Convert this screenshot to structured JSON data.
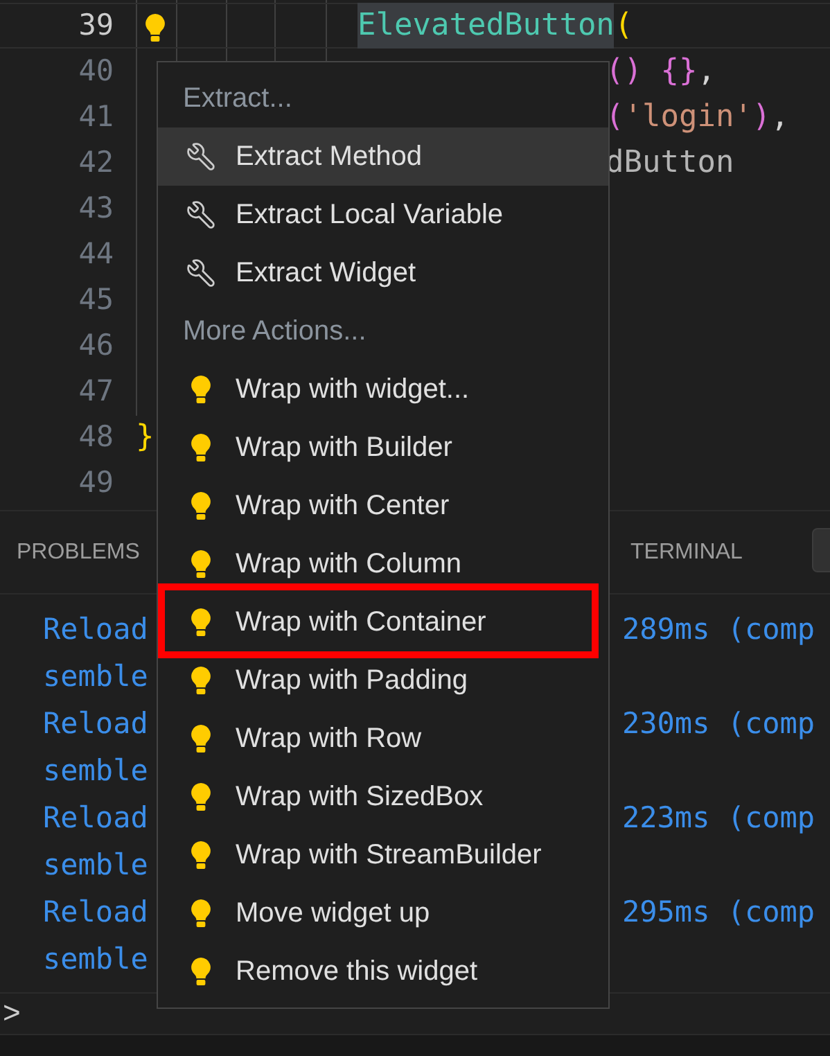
{
  "editor": {
    "lines": [
      {
        "number": "39",
        "current": true,
        "lightbulb": true,
        "code": [
          {
            "text": "ElevatedButton",
            "color": "#4ec9b0",
            "selected": true
          },
          {
            "text": "(",
            "color": "#ffd700",
            "selected": false
          }
        ]
      },
      {
        "number": "40",
        "current": false,
        "lightbulb": false,
        "code": [
          {
            "text": "()",
            "color": "#da70d6",
            "selected": false
          },
          {
            "text": " {}",
            "color": "#da70d6",
            "selected": false
          },
          {
            "text": ",",
            "color": "#d4d4d4",
            "selected": false
          }
        ]
      },
      {
        "number": "41",
        "current": false,
        "lightbulb": false,
        "code": [
          {
            "text": "(",
            "color": "#da70d6",
            "selected": false
          },
          {
            "text": "'login'",
            "color": "#ce9178",
            "selected": false
          },
          {
            "text": ")",
            "color": "#da70d6",
            "selected": false
          },
          {
            "text": ",",
            "color": "#d4d4d4",
            "selected": false
          }
        ]
      },
      {
        "number": "42",
        "current": false,
        "lightbulb": false,
        "code": [
          {
            "text": "dButton",
            "color": "#b4b4b4",
            "selected": false
          }
        ]
      },
      {
        "number": "43",
        "current": false,
        "lightbulb": false
      },
      {
        "number": "44",
        "current": false,
        "lightbulb": false
      },
      {
        "number": "45",
        "current": false,
        "lightbulb": false
      },
      {
        "number": "46",
        "current": false,
        "lightbulb": false
      },
      {
        "number": "47",
        "current": false,
        "lightbulb": false
      },
      {
        "number": "48",
        "current": false,
        "lightbulb": false,
        "code": [
          {
            "text": "}",
            "color": "#ffd700",
            "selected": false
          }
        ]
      },
      {
        "number": "49",
        "current": false,
        "lightbulb": false
      }
    ]
  },
  "panel": {
    "tabs": [
      {
        "label": "PROBLEMS",
        "selected": false
      },
      {
        "label": "TERMINAL",
        "selected": false
      }
    ],
    "terminal_lines": [
      {
        "left": "Reload",
        "right": "289ms (comp"
      },
      {
        "left": "semble"
      },
      {
        "left": "Reload",
        "right": "230ms (comp"
      },
      {
        "left": "semble"
      },
      {
        "left": "Reload",
        "right": "223ms (comp"
      },
      {
        "left": "semble"
      },
      {
        "left": "Reload",
        "right": "295ms (comp"
      },
      {
        "left": "semble"
      }
    ],
    "prompt": ">"
  },
  "context_menu": {
    "items": [
      {
        "kind": "header",
        "label": "Extract..."
      },
      {
        "kind": "extract",
        "label": "Extract Method",
        "selected": true,
        "annotated": false
      },
      {
        "kind": "extract",
        "label": "Extract Local Variable",
        "selected": false,
        "annotated": false
      },
      {
        "kind": "extract",
        "label": "Extract Widget",
        "selected": false,
        "annotated": false
      },
      {
        "kind": "header",
        "label": "More Actions..."
      },
      {
        "kind": "action",
        "label": "Wrap with widget...",
        "selected": false,
        "annotated": false
      },
      {
        "kind": "action",
        "label": "Wrap with Builder",
        "selected": false,
        "annotated": false
      },
      {
        "kind": "action",
        "label": "Wrap with Center",
        "selected": false,
        "annotated": false
      },
      {
        "kind": "action",
        "label": "Wrap with Column",
        "selected": false,
        "annotated": false
      },
      {
        "kind": "action",
        "label": "Wrap with Container",
        "selected": false,
        "annotated": true
      },
      {
        "kind": "action",
        "label": "Wrap with Padding",
        "selected": false,
        "annotated": false
      },
      {
        "kind": "action",
        "label": "Wrap with Row",
        "selected": false,
        "annotated": false
      },
      {
        "kind": "action",
        "label": "Wrap with SizedBox",
        "selected": false,
        "annotated": false
      },
      {
        "kind": "action",
        "label": "Wrap with StreamBuilder",
        "selected": false,
        "annotated": false
      },
      {
        "kind": "action",
        "label": "Move widget up",
        "selected": false,
        "annotated": false
      },
      {
        "kind": "action",
        "label": "Remove this widget",
        "selected": false,
        "annotated": false
      }
    ]
  }
}
